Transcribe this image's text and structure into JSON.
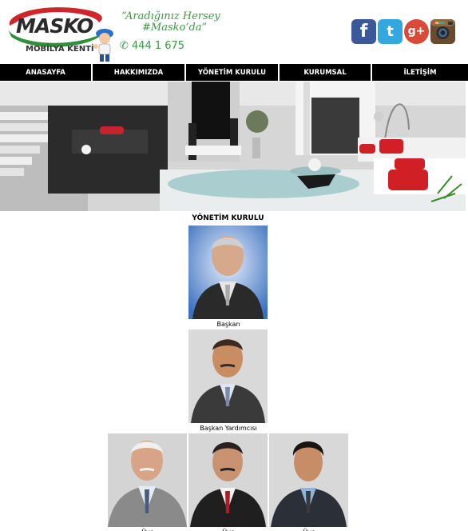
{
  "brand": {
    "logo_text": "MASKO",
    "logo_sub": "MOBİLYA KENTİ",
    "slogan_line1": "“Aradığınız Hersey",
    "slogan_line2": "#Masko’da”",
    "phone": "444 1 675"
  },
  "social": {
    "facebook": "f",
    "twitter": "t",
    "googleplus": "g+"
  },
  "nav": {
    "items": [
      {
        "label": "ANASAYFA"
      },
      {
        "label": "HAKKIMIZDA"
      },
      {
        "label": "YÖNETİM KURULU"
      },
      {
        "label": "KURUMSAL"
      },
      {
        "label": "İLETİŞİM"
      }
    ]
  },
  "main": {
    "title": "YÖNETİM KURULU",
    "members": [
      {
        "role": "Başkan"
      },
      {
        "role": "Başkan Yardımcısı"
      },
      {
        "role": "Üye"
      },
      {
        "role": "Üye"
      },
      {
        "role": "Üye"
      }
    ]
  },
  "colors": {
    "brand_green": "#3a9a44",
    "logo_red": "#d0262b",
    "nav_bg": "#000000",
    "facebook": "#3b5998",
    "twitter": "#33a8e0",
    "googleplus": "#d94a39"
  }
}
